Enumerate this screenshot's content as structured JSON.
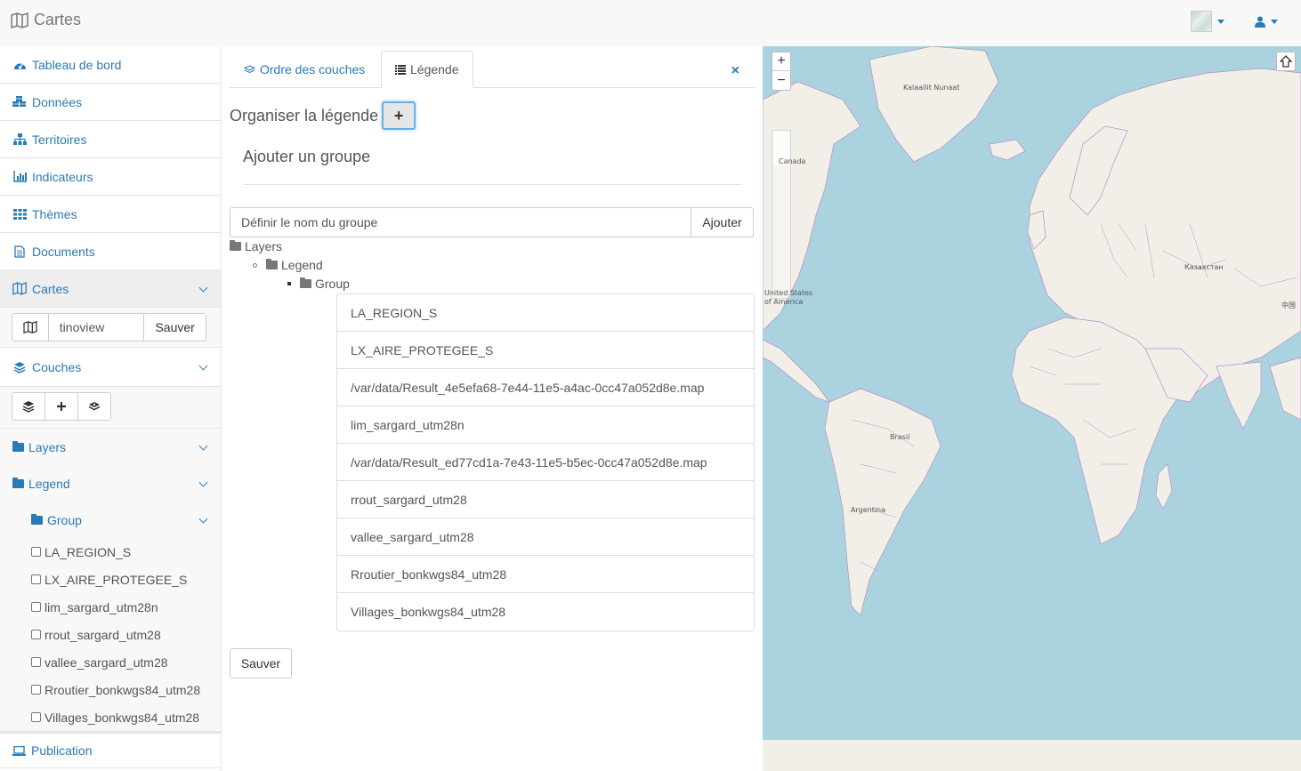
{
  "app": {
    "title": "Cartes"
  },
  "topbar": {
    "user_icon": "user-icon",
    "map_thumb": "map-thumbnail"
  },
  "sidebar": {
    "items": [
      {
        "label": "Tableau de bord",
        "icon": "dashboard-icon"
      },
      {
        "label": "Données",
        "icon": "cubes-icon"
      },
      {
        "label": "Territoires",
        "icon": "sitemap-icon"
      },
      {
        "label": "Indicateurs",
        "icon": "bar-chart-icon"
      },
      {
        "label": "Thèmes",
        "icon": "grid-icon"
      },
      {
        "label": "Documents",
        "icon": "document-icon"
      },
      {
        "label": "Cartes",
        "icon": "map-icon"
      }
    ],
    "map_name": {
      "value": "tinoview",
      "save_label": "Sauver"
    },
    "couches": {
      "label": "Couches"
    },
    "tree": {
      "layers": "Layers",
      "legend": "Legend",
      "group": "Group",
      "items": [
        "LA_REGION_S",
        "LX_AIRE_PROTEGEE_S",
        "lim_sargard_utm28n",
        "rrout_sargard_utm28",
        "vallee_sargard_utm28",
        "Rroutier_bonkwgs84_utm28",
        "Villages_bonkwgs84_utm28"
      ]
    },
    "publication": {
      "label": "Publication"
    }
  },
  "main": {
    "tabs": [
      {
        "label": "Ordre des couches"
      },
      {
        "label": "Légende"
      }
    ],
    "close_label": "×",
    "organize_title": "Organiser la légende",
    "add_button_label": "+",
    "add_group_title": "Ajouter un groupe",
    "group_input_placeholder": "Définir le nom du groupe",
    "add_label": "Ajouter",
    "tree": {
      "layers": "Layers",
      "legend": "Legend",
      "group": "Group"
    },
    "list_items": [
      "LA_REGION_S",
      "LX_AIRE_PROTEGEE_S",
      "/var/data/Result_4e5efa68-7e44-11e5-a4ac-0cc47a052d8e.map",
      "lim_sargard_utm28n",
      "/var/data/Result_ed77cd1a-7e43-11e5-b5ec-0cc47a052d8e.map",
      "rrout_sargard_utm28",
      "vallee_sargard_utm28",
      "Rroutier_bonkwgs84_utm28",
      "Villages_bonkwgs84_utm28"
    ],
    "save_label": "Sauver"
  },
  "map": {
    "zoom_in": "+",
    "zoom_out": "−",
    "labels": {
      "greenland": "Kalaallit Nunaat",
      "canada": "Canada",
      "usa_1": "United States",
      "usa_2": "of America",
      "kazakhstan": "Казахстан",
      "china": "中国",
      "brasil": "Brasil",
      "argentina": "Argentina"
    }
  }
}
